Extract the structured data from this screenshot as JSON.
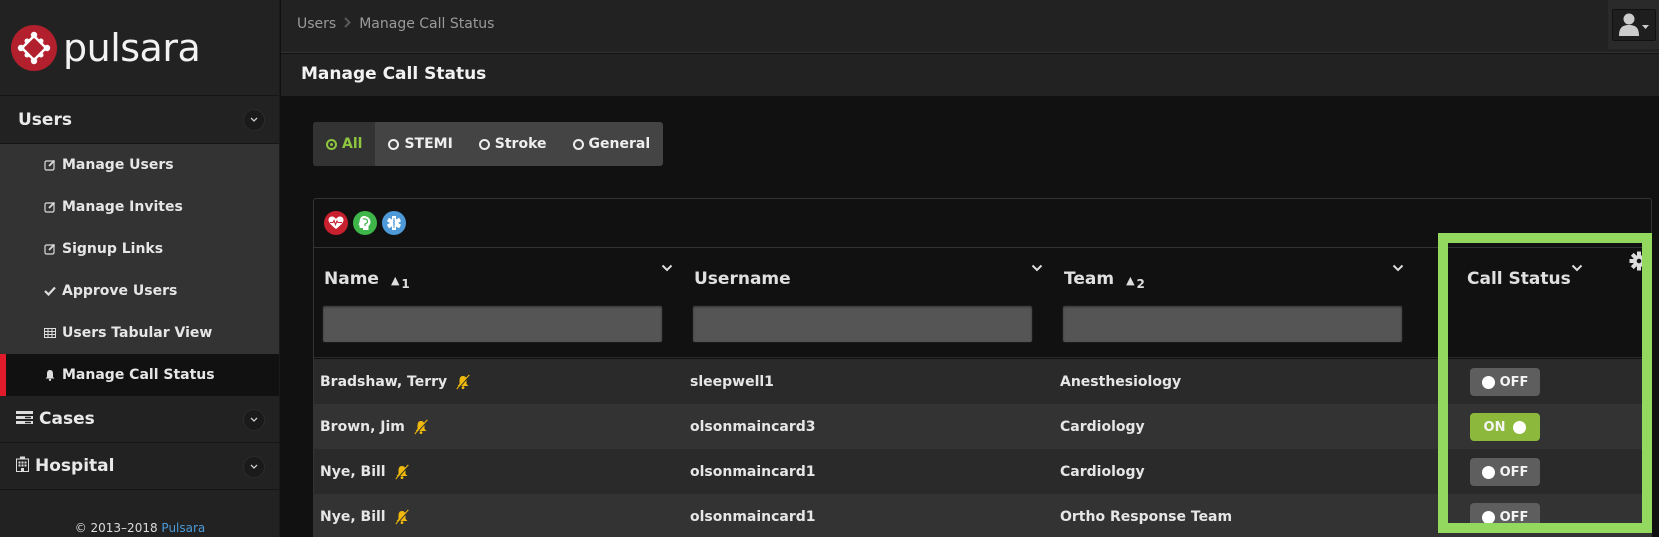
{
  "brand": {
    "name": "pulsara",
    "logo_color": "#b3202d"
  },
  "sidebar": {
    "sections": [
      {
        "label": "Users",
        "expanded": true,
        "items": [
          {
            "label": "Manage Users",
            "icon": "edit-icon"
          },
          {
            "label": "Manage Invites",
            "icon": "edit-icon"
          },
          {
            "label": "Signup Links",
            "icon": "edit-icon"
          },
          {
            "label": "Approve Users",
            "icon": "check-icon"
          },
          {
            "label": "Users Tabular View",
            "icon": "table-icon"
          },
          {
            "label": "Manage Call Status",
            "icon": "bell-icon",
            "active": true
          }
        ]
      },
      {
        "label": "Cases",
        "icon": "cases-icon",
        "expanded": false
      },
      {
        "label": "Hospital",
        "icon": "hospital-icon",
        "expanded": false
      }
    ],
    "footer": {
      "copyright": "© 2013–2018 ",
      "link": "Pulsara"
    },
    "active_accent": "#e11b2a"
  },
  "topbar": {
    "breadcrumb": [
      "Users",
      "Manage Call Status"
    ],
    "user_menu_icon": "user-icon"
  },
  "page": {
    "title": "Manage Call Status"
  },
  "filters": {
    "options": [
      "All",
      "STEMI",
      "Stroke",
      "General"
    ],
    "selected": "All",
    "accent": "#8ec63f"
  },
  "category_icons": [
    {
      "name": "stemi-heart-icon",
      "color": "#c8202f"
    },
    {
      "name": "stroke-head-icon",
      "color": "#3fb64a"
    },
    {
      "name": "general-star-of-life-icon",
      "color": "#4e9ad8"
    }
  ],
  "table": {
    "columns": [
      {
        "label": "Name",
        "sort": "asc",
        "sort_order": "1"
      },
      {
        "label": "Username"
      },
      {
        "label": "Team",
        "sort": "asc",
        "sort_order": "2"
      },
      {
        "label": "Call Status"
      }
    ],
    "filters": {
      "name": "",
      "username": "",
      "team": ""
    },
    "rows": [
      {
        "name": "Bradshaw, Terry",
        "muted": true,
        "username": "sleepwell1",
        "team": "Anesthesiology",
        "status": "OFF"
      },
      {
        "name": "Brown, Jim",
        "muted": true,
        "username": "olsonmaincard3",
        "team": "Cardiology",
        "status": "ON"
      },
      {
        "name": "Nye, Bill",
        "muted": true,
        "username": "olsonmaincard1",
        "team": "Cardiology",
        "status": "OFF"
      },
      {
        "name": "Nye, Bill",
        "muted": true,
        "username": "olsonmaincard1",
        "team": "Ortho Response Team",
        "status": "OFF"
      }
    ],
    "toggle_colors": {
      "on": "#8cb93b",
      "off": "#5e5e5e"
    }
  },
  "annotation": {
    "highlight_color": "#94d95f",
    "target": "Call Status column"
  }
}
